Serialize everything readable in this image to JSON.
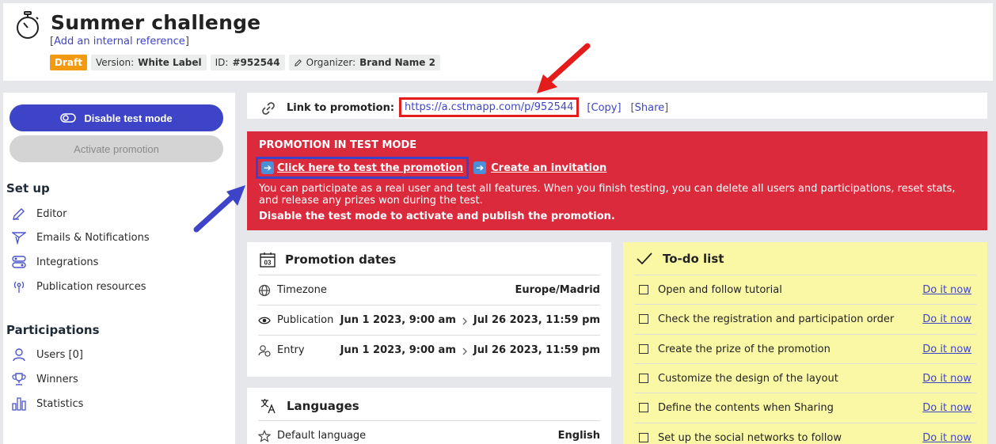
{
  "header": {
    "title": "Summer challenge",
    "reference_prefix": "[",
    "reference_link": "Add an internal reference",
    "reference_suffix": "]",
    "badges": {
      "draft": "Draft",
      "version_label": "Version:",
      "version_value": "White Label",
      "id_label": "ID:",
      "id_value": "#952544",
      "organizer_label": "Organizer:",
      "organizer_value": "Brand Name 2"
    }
  },
  "sidebar": {
    "disable_test_mode": "Disable test mode",
    "activate_promotion": "Activate promotion",
    "setup_title": "Set up",
    "setup_items": [
      "Editor",
      "Emails & Notifications",
      "Integrations",
      "Publication resources"
    ],
    "participations_title": "Participations",
    "participation_items": [
      "Users [0]",
      "Winners",
      "Statistics"
    ]
  },
  "link_bar": {
    "label": "Link to promotion:",
    "url": "https://a.cstmapp.com/p/952544",
    "copy": "[Copy]",
    "share": "Share"
  },
  "test_mode": {
    "title": "PROMOTION IN TEST MODE",
    "test_link": "Click here to test the promotion",
    "invite_link": "Create an invitation",
    "description": "You can participate as a real user and test all features. When you finish testing, you can delete all users and participations, reset stats, and release any prizes won during the test.",
    "warning": "Disable the test mode to activate and publish the promotion."
  },
  "promotion_dates": {
    "title": "Promotion dates",
    "calendar_number": "03",
    "rows": [
      {
        "label": "Timezone",
        "value": "Europe/Madrid"
      },
      {
        "label": "Publication",
        "start": "Jun 1 2023, 9:00 am",
        "end": "Jul 26 2023, 11:59 pm"
      },
      {
        "label": "Entry",
        "start": "Jun 1 2023, 9:00 am",
        "end": "Jul 26 2023, 11:59 pm"
      }
    ]
  },
  "languages": {
    "title": "Languages",
    "default_label": "Default language",
    "default_value": "English"
  },
  "todo": {
    "title": "To-do list",
    "action": "Do it now",
    "items": [
      "Open and follow tutorial",
      "Check the registration and participation order",
      "Create the prize of the promotion",
      "Customize the design of the layout",
      "Define the contents when Sharing",
      "Set up the social networks to follow"
    ]
  },
  "colors": {
    "primary": "#3e44c8",
    "alert_red": "#dc2a3d",
    "draft_orange": "#f39a11",
    "todo_yellow": "#fbf8a5",
    "annotation_red": "#e41c1c",
    "annotation_blue": "#3e44c8"
  }
}
